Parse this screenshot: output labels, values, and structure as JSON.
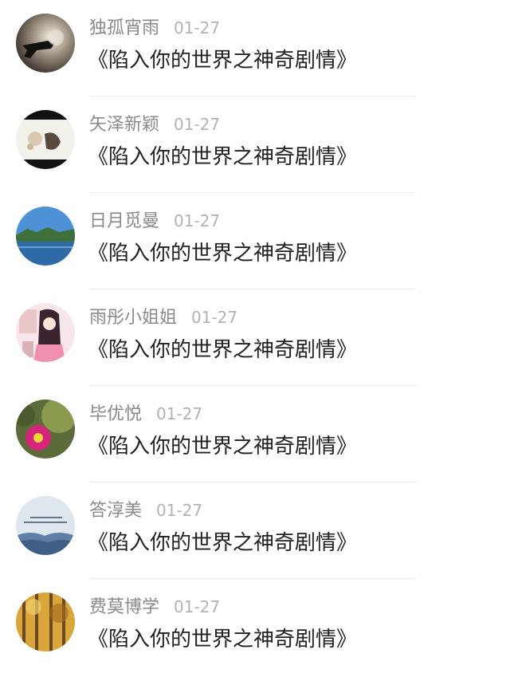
{
  "items": [
    {
      "name": "独孤宵雨",
      "date": "01-27",
      "title": "《陷入你的世界之神奇剧情》",
      "avatar_icon": "revolver-smoke-avatar"
    },
    {
      "name": "矢泽新颖",
      "date": "01-27",
      "title": "《陷入你的世界之神奇剧情》",
      "avatar_icon": "girl-flowers-avatar"
    },
    {
      "name": "日月觅曼",
      "date": "01-27",
      "title": "《陷入你的世界之神奇剧情》",
      "avatar_icon": "lake-mountain-avatar"
    },
    {
      "name": "雨彤小姐姐",
      "date": "01-27",
      "title": "《陷入你的世界之神奇剧情》",
      "avatar_icon": "anime-girl-avatar"
    },
    {
      "name": "毕优悦",
      "date": "01-27",
      "title": "《陷入你的世界之神奇剧情》",
      "avatar_icon": "cactus-flower-avatar"
    },
    {
      "name": "答淳美",
      "date": "01-27",
      "title": "《陷入你的世界之神奇剧情》",
      "avatar_icon": "cloud-sea-text-avatar"
    },
    {
      "name": "费莫博学",
      "date": "01-27",
      "title": "《陷入你的世界之神奇剧情》",
      "avatar_icon": "autumn-forest-avatar"
    }
  ]
}
